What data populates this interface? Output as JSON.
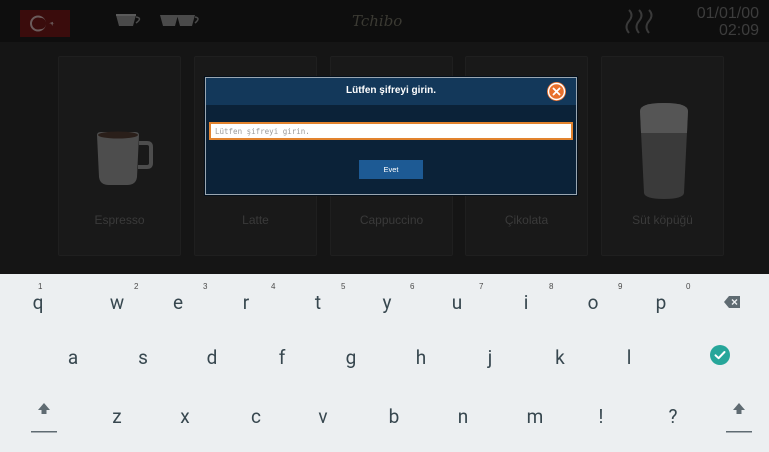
{
  "header": {
    "brand": "Tchibo",
    "date": "01/01/00",
    "time": "02:09",
    "language_flag": "turkish-flag-icon"
  },
  "products": [
    {
      "label": "Espresso",
      "icon": "espresso-cup-icon"
    },
    {
      "label": "Latte",
      "icon": "latte-glass-icon"
    },
    {
      "label": "Cappuccino",
      "icon": "cappuccino-cup-icon"
    },
    {
      "label": "Çikolata",
      "icon": "chocolate-cup-icon"
    },
    {
      "label": "Süt köpüğü",
      "icon": "milk-foam-glass-icon"
    }
  ],
  "modal": {
    "title": "Lütfen şifreyi girin.",
    "input_placeholder": "Lütfen şifreyi girin.",
    "input_value": "",
    "submit_label": "Evet",
    "close_icon": "close-icon"
  },
  "keyboard": {
    "row1": [
      {
        "key": "q",
        "hint": "1"
      },
      {
        "key": "w",
        "hint": "2"
      },
      {
        "key": "e",
        "hint": "3"
      },
      {
        "key": "r",
        "hint": "4"
      },
      {
        "key": "t",
        "hint": "5"
      },
      {
        "key": "y",
        "hint": "6"
      },
      {
        "key": "u",
        "hint": "7"
      },
      {
        "key": "i",
        "hint": "8"
      },
      {
        "key": "o",
        "hint": "9"
      },
      {
        "key": "p",
        "hint": "0"
      }
    ],
    "row2": [
      "a",
      "s",
      "d",
      "f",
      "g",
      "h",
      "j",
      "k",
      "l"
    ],
    "row3": [
      "z",
      "x",
      "c",
      "v",
      "b",
      "n",
      "m",
      "!",
      "?"
    ],
    "backspace_icon": "backspace-icon",
    "enter_icon": "check-circle-icon",
    "shift_icon": "shift-icon",
    "accent_color": "#26a69a"
  }
}
